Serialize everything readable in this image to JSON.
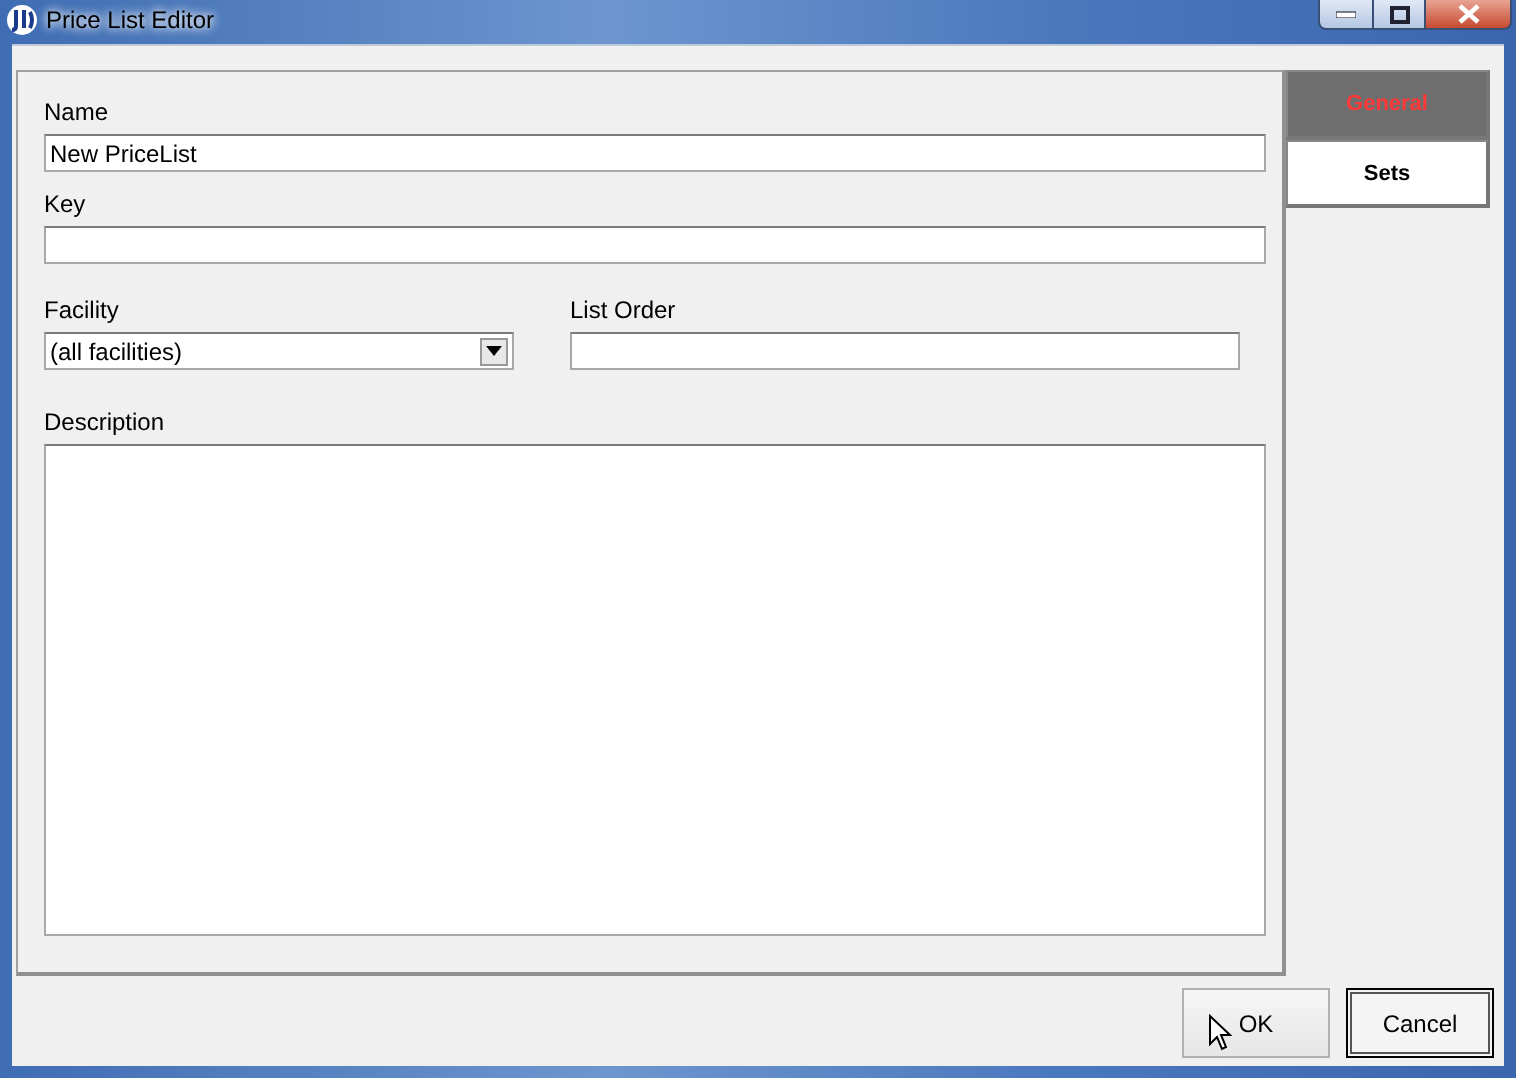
{
  "window": {
    "title": "Price List Editor"
  },
  "rows": [
    {
      "fields": [
        {
          "kind": "text",
          "label": "Name",
          "value": "New PriceList"
        }
      ]
    },
    {
      "fields": [
        {
          "kind": "text",
          "label": "Key"
        }
      ]
    },
    {
      "fields": [
        {
          "kind": "select",
          "label": "Facility",
          "value": "(all facilities)"
        },
        {
          "kind": "text",
          "label": "List Order"
        }
      ]
    },
    {
      "fields": [
        {
          "kind": "textarea",
          "label": "Description"
        }
      ]
    }
  ],
  "tabs": [
    {
      "label": "General",
      "selected": true
    },
    {
      "label": "Sets",
      "selected": false
    }
  ],
  "buttons": [
    {
      "label": "OK",
      "default": false
    },
    {
      "label": "Cancel",
      "default": true
    }
  ]
}
